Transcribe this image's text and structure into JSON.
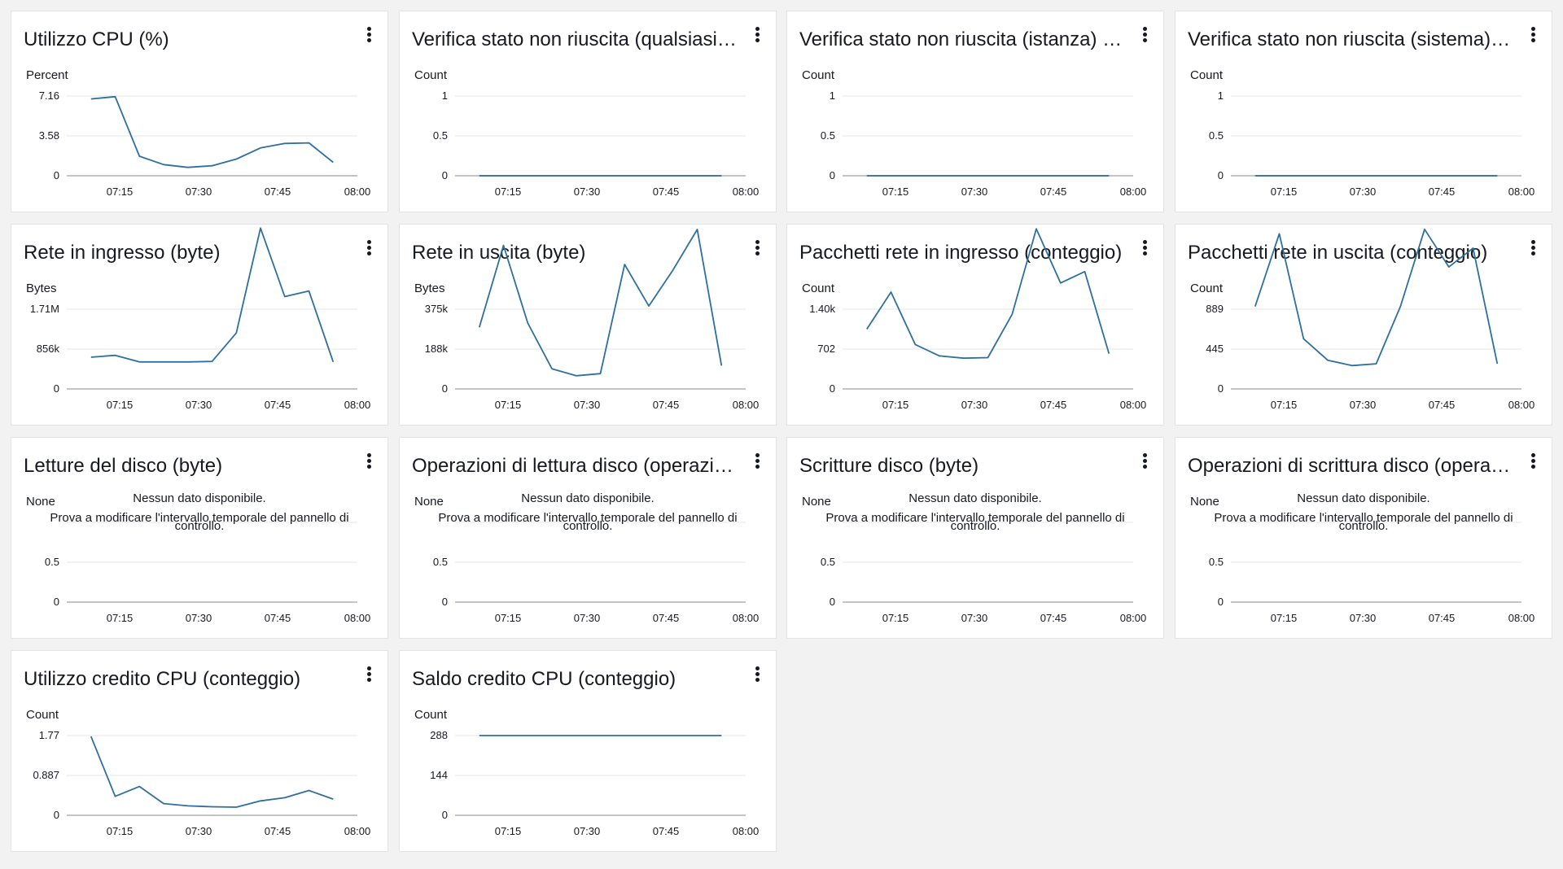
{
  "colors": {
    "line": "#2e6f9e",
    "grid": "#e6e6e6",
    "axis": "#c4c4c4"
  },
  "x_ticks": [
    "07:15",
    "07:30",
    "07:45",
    "08:00"
  ],
  "no_data": {
    "title": "Nessun dato disponibile.",
    "line1": "Prova a modificare l'intervallo temporale del pannello di",
    "line2": "controllo."
  },
  "widgets": [
    {
      "title": "Utilizzo CPU (%)",
      "unit": "Percent",
      "chart_data": {
        "type": "line",
        "ymax": 7.16,
        "yticks": [
          "7.16",
          "3.58",
          "0"
        ],
        "x": [
          "07:05",
          "07:10",
          "07:15",
          "07:20",
          "07:25",
          "07:30",
          "07:35",
          "07:40",
          "07:45",
          "07:50",
          "07:55"
        ],
        "values": [
          6.9,
          7.1,
          1.75,
          1.0,
          0.75,
          0.9,
          1.5,
          2.5,
          2.9,
          2.95,
          1.2
        ]
      }
    },
    {
      "title": "Verifica stato non riuscita (qualsiasi) (conteggio)",
      "unit": "Count",
      "chart_data": {
        "type": "line",
        "ymax": 1,
        "yticks": [
          "1",
          "0.5",
          "0"
        ],
        "x": [
          "07:05",
          "07:10",
          "07:15",
          "07:20",
          "07:25",
          "07:30",
          "07:35",
          "07:40",
          "07:45",
          "07:50",
          "07:55"
        ],
        "values": [
          0,
          0,
          0,
          0,
          0,
          0,
          0,
          0,
          0,
          0,
          0
        ]
      }
    },
    {
      "title": "Verifica stato non riuscita (istanza) (conteggio)",
      "unit": "Count",
      "chart_data": {
        "type": "line",
        "ymax": 1,
        "yticks": [
          "1",
          "0.5",
          "0"
        ],
        "x": [
          "07:05",
          "07:10",
          "07:15",
          "07:20",
          "07:25",
          "07:30",
          "07:35",
          "07:40",
          "07:45",
          "07:50",
          "07:55"
        ],
        "values": [
          0,
          0,
          0,
          0,
          0,
          0,
          0,
          0,
          0,
          0,
          0
        ]
      }
    },
    {
      "title": "Verifica stato non riuscita (sistema) (conteggio)",
      "unit": "Count",
      "chart_data": {
        "type": "line",
        "ymax": 1,
        "yticks": [
          "1",
          "0.5",
          "0"
        ],
        "x": [
          "07:05",
          "07:10",
          "07:15",
          "07:20",
          "07:25",
          "07:30",
          "07:35",
          "07:40",
          "07:45",
          "07:50",
          "07:55"
        ],
        "values": [
          0,
          0,
          0,
          0,
          0,
          0,
          0,
          0,
          0,
          0,
          0
        ]
      }
    },
    {
      "title": "Rete in ingresso (byte)",
      "unit": "Bytes",
      "chart_data": {
        "type": "line",
        "ymax": 1710000,
        "yticks": [
          "1.71M",
          "856k",
          "0"
        ],
        "x": [
          "07:05",
          "07:10",
          "07:15",
          "07:20",
          "07:25",
          "07:30",
          "07:35",
          "07:40",
          "07:45",
          "07:50",
          "07:55"
        ],
        "values": [
          680000,
          720000,
          580000,
          580000,
          580000,
          590000,
          1200000,
          3450000,
          1980000,
          2100000,
          580000
        ]
      }
    },
    {
      "title": "Rete in uscita (byte)",
      "unit": "Bytes",
      "chart_data": {
        "type": "line",
        "ymax": 375000,
        "yticks": [
          "375k",
          "188k",
          "0"
        ],
        "x": [
          "07:05",
          "07:10",
          "07:15",
          "07:20",
          "07:25",
          "07:30",
          "07:35",
          "07:40",
          "07:45",
          "07:50",
          "07:55"
        ],
        "values": [
          290000,
          675000,
          310000,
          95000,
          62000,
          72000,
          585000,
          390000,
          560000,
          750000,
          110000
        ]
      }
    },
    {
      "title": "Pacchetti rete in ingresso (conteggio)",
      "unit": "Count",
      "chart_data": {
        "type": "line",
        "ymax": 1400,
        "yticks": [
          "1.40k",
          "702",
          "0"
        ],
        "x": [
          "07:05",
          "07:10",
          "07:15",
          "07:20",
          "07:25",
          "07:30",
          "07:35",
          "07:40",
          "07:45",
          "07:50",
          "07:55"
        ],
        "values": [
          1050,
          1700,
          780,
          580,
          540,
          550,
          1310,
          2810,
          1860,
          2060,
          620
        ]
      }
    },
    {
      "title": "Pacchetti rete in uscita (conteggio)",
      "unit": "Count",
      "chart_data": {
        "type": "line",
        "ymax": 889,
        "yticks": [
          "889",
          "445",
          "0"
        ],
        "x": [
          "07:05",
          "07:10",
          "07:15",
          "07:20",
          "07:25",
          "07:30",
          "07:35",
          "07:40",
          "07:45",
          "07:50",
          "07:55"
        ],
        "values": [
          920,
          1730,
          560,
          320,
          260,
          280,
          920,
          1780,
          1360,
          1570,
          280
        ]
      }
    },
    {
      "title": "Letture del disco (byte)",
      "unit": "None",
      "nodata": true,
      "chart_data": {
        "type": "line",
        "ymax": 1,
        "yticks": [
          "",
          "0.5",
          "0"
        ],
        "x": [],
        "values": []
      }
    },
    {
      "title": "Operazioni di lettura disco (operazioni)",
      "unit": "None",
      "nodata": true,
      "chart_data": {
        "type": "line",
        "ymax": 1,
        "yticks": [
          "",
          "0.5",
          "0"
        ],
        "x": [],
        "values": []
      }
    },
    {
      "title": "Scritture disco (byte)",
      "unit": "None",
      "nodata": true,
      "chart_data": {
        "type": "line",
        "ymax": 1,
        "yticks": [
          "",
          "0.5",
          "0"
        ],
        "x": [],
        "values": []
      }
    },
    {
      "title": "Operazioni di scrittura disco (operazioni)",
      "unit": "None",
      "nodata": true,
      "chart_data": {
        "type": "line",
        "ymax": 1,
        "yticks": [
          "",
          "0.5",
          "0"
        ],
        "x": [],
        "values": []
      }
    },
    {
      "title": "Utilizzo credito CPU (conteggio)",
      "unit": "Count",
      "chart_data": {
        "type": "line",
        "ymax": 1.77,
        "yticks": [
          "1.77",
          "0.887",
          "0"
        ],
        "x": [
          "07:05",
          "07:10",
          "07:15",
          "07:20",
          "07:25",
          "07:30",
          "07:35",
          "07:40",
          "07:45",
          "07:50",
          "07:55"
        ],
        "values": [
          1.75,
          0.42,
          0.64,
          0.26,
          0.21,
          0.19,
          0.18,
          0.32,
          0.39,
          0.55,
          0.36
        ]
      }
    },
    {
      "title": "Saldo credito CPU (conteggio)",
      "unit": "Count",
      "chart_data": {
        "type": "line",
        "ymax": 288,
        "yticks": [
          "288",
          "144",
          "0"
        ],
        "x": [
          "07:05",
          "07:10",
          "07:15",
          "07:20",
          "07:25",
          "07:30",
          "07:35",
          "07:40",
          "07:45",
          "07:50",
          "07:55"
        ],
        "values": [
          288,
          288,
          288,
          288,
          288,
          288,
          288,
          288,
          288,
          288,
          288
        ]
      }
    }
  ]
}
